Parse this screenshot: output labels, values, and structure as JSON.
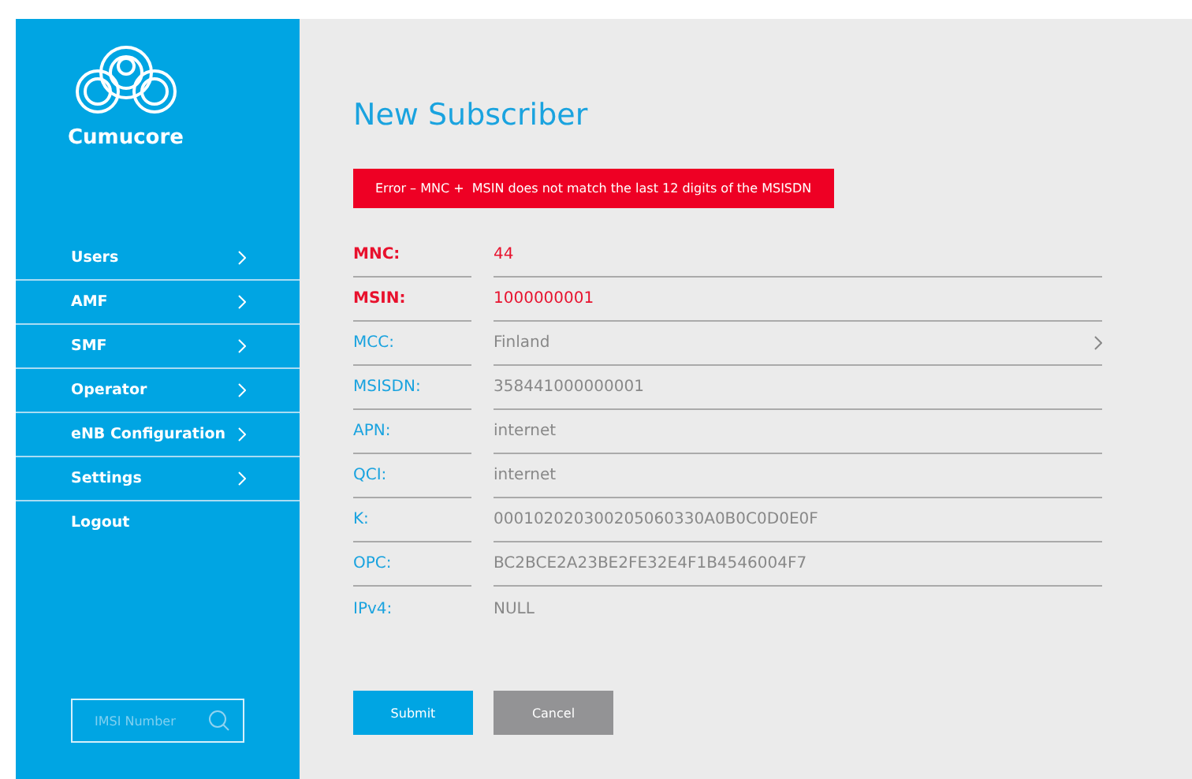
{
  "brand": {
    "name": "Cumucore"
  },
  "sidebar": {
    "items": [
      {
        "label": "Users",
        "kind": "submenu"
      },
      {
        "label": "AMF",
        "kind": "submenu"
      },
      {
        "label": "SMF",
        "kind": "submenu"
      },
      {
        "label": "Operator",
        "kind": "submenu"
      },
      {
        "label": "eNB Configuration",
        "kind": "submenu"
      },
      {
        "label": "Settings",
        "kind": "submenu"
      },
      {
        "label": "Logout",
        "kind": "link"
      }
    ],
    "search": {
      "placeholder": "IMSI Number"
    }
  },
  "page": {
    "title": "New Subscriber",
    "error": "Error – MNC +  MSIN does not match the last 12 digits of the MSISDN"
  },
  "fields": [
    {
      "label": "MNC:",
      "value": "44",
      "kind": "text",
      "error": true
    },
    {
      "label": "MSIN:",
      "value": "1000000001",
      "kind": "text",
      "error": true
    },
    {
      "label": "MCC:",
      "value": "Finland",
      "kind": "select",
      "error": false
    },
    {
      "label": "MSISDN:",
      "value": "358441000000001",
      "kind": "text",
      "error": false
    },
    {
      "label": "APN:",
      "value": "internet",
      "kind": "text",
      "error": false
    },
    {
      "label": "QCI:",
      "value": "internet",
      "kind": "text",
      "error": false
    },
    {
      "label": "K:",
      "value": "000102020300205060330A0B0C0D0E0F",
      "kind": "text",
      "error": false
    },
    {
      "label": "OPC:",
      "value": "BC2BCE2A23BE2FE32E4F1B4546004F7",
      "kind": "text",
      "error": false
    },
    {
      "label": "IPv4:",
      "value": "NULL",
      "kind": "plain",
      "error": false
    }
  ],
  "buttons": [
    {
      "label": "Submit",
      "kind": "primary"
    },
    {
      "label": "Cancel",
      "kind": "secondary"
    }
  ]
}
